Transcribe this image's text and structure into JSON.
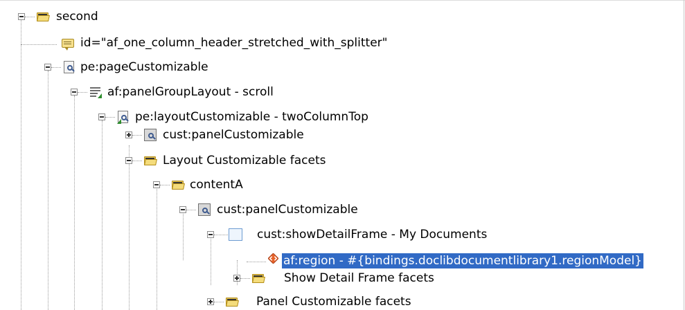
{
  "tree": {
    "nodes": [
      {
        "label": "second",
        "icon": "folder-icon",
        "expanded": true
      },
      {
        "label": "id=\"af_one_column_header_stretched_with_splitter\"",
        "icon": "comment-icon"
      },
      {
        "label": "pe:pageCustomizable",
        "icon": "page-customizable-icon",
        "expanded": true
      },
      {
        "label": "af:panelGroupLayout - scroll",
        "icon": "panel-group-layout-icon",
        "expanded": true
      },
      {
        "label": "pe:layoutCustomizable - twoColumnTop",
        "icon": "layout-customizable-icon",
        "expanded": true
      },
      {
        "label": "cust:panelCustomizable",
        "icon": "panel-customizable-icon",
        "expanded": false
      },
      {
        "label": "Layout Customizable facets",
        "icon": "folder-icon",
        "expanded": true
      },
      {
        "label": "contentA",
        "icon": "folder-icon",
        "expanded": true
      },
      {
        "label": "cust:panelCustomizable",
        "icon": "panel-customizable-icon",
        "expanded": true
      },
      {
        "label": "cust:showDetailFrame - My Documents",
        "icon": "show-detail-frame-icon",
        "expanded": true
      },
      {
        "label": "af:region - #{bindings.doclibdocumentlibrary1.regionModel}",
        "icon": "region-icon",
        "selected": true
      },
      {
        "label": "Show Detail Frame facets",
        "icon": "folder-icon",
        "expanded": false
      },
      {
        "label": "Panel Customizable facets",
        "icon": "folder-icon",
        "expanded": false
      }
    ]
  },
  "colors": {
    "selection": "#316ac5",
    "folder": "#e9c95a",
    "region": "#e8632a"
  }
}
